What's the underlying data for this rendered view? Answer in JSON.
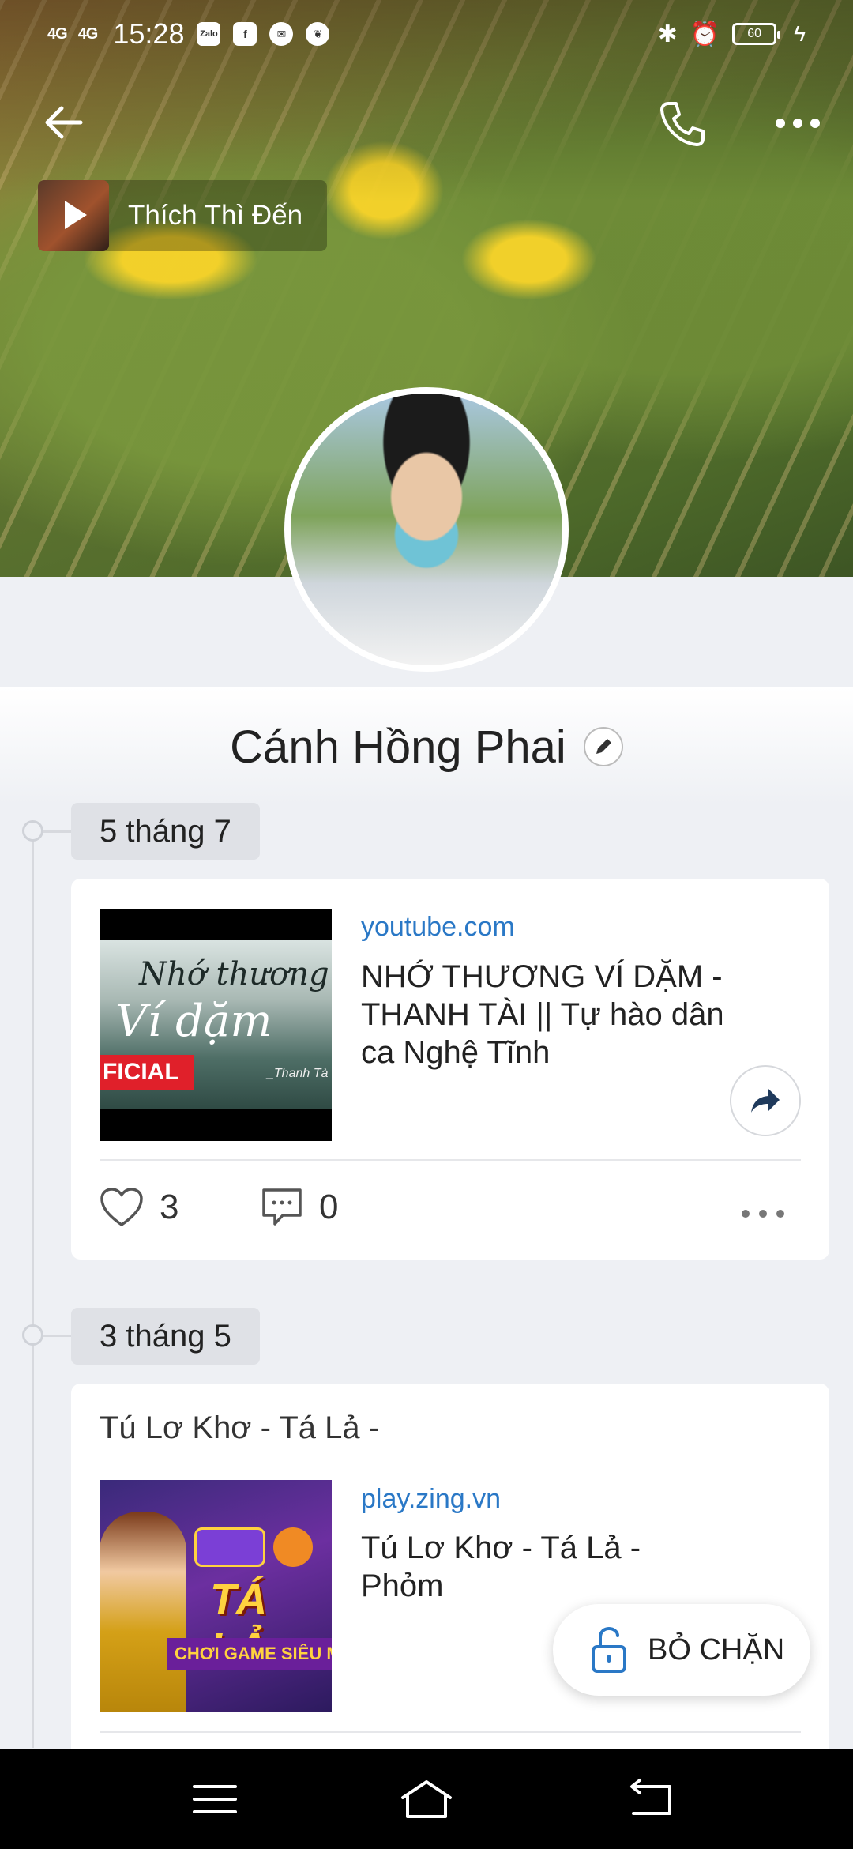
{
  "status_bar": {
    "signal1": "4G",
    "signal2": "4G",
    "time": "15:28",
    "app1": "Zalo",
    "battery": "60"
  },
  "header": {
    "back_icon": "arrow-left-icon",
    "call_icon": "phone-icon",
    "more_icon": "ellipsis-icon"
  },
  "music": {
    "title": "Thích Thì Đến"
  },
  "profile": {
    "name": "Cánh Hồng Phai"
  },
  "timeline": [
    {
      "date": "5 tháng 7",
      "post": {
        "text": "",
        "link_domain": "youtube.com",
        "link_title": "NHỚ THƯƠNG VÍ DẶM - THANH TÀI || Tự hào dân ca Nghệ Tĩnh",
        "thumb_text1": "Nhớ thương",
        "thumb_text2": "Ví dặm",
        "thumb_ribbon": "FICIAL",
        "thumb_small": "_Thanh Tà",
        "likes": "3",
        "comments": "0"
      }
    },
    {
      "date": "3 tháng 5",
      "post": {
        "text": "Tú Lơ Khơ - Tá Lả -",
        "link_domain": "play.zing.vn",
        "link_title": "Tú Lơ Khơ - Tá Lả - Phỏm",
        "thumb_text1": "TÁ LẢ",
        "thumb_text2": "CHƠI GAME SIÊU M"
      }
    }
  ],
  "unblock": {
    "label": "BỎ CHẶN"
  },
  "colors": {
    "link": "#2a78c6",
    "background": "#eef0f4"
  }
}
